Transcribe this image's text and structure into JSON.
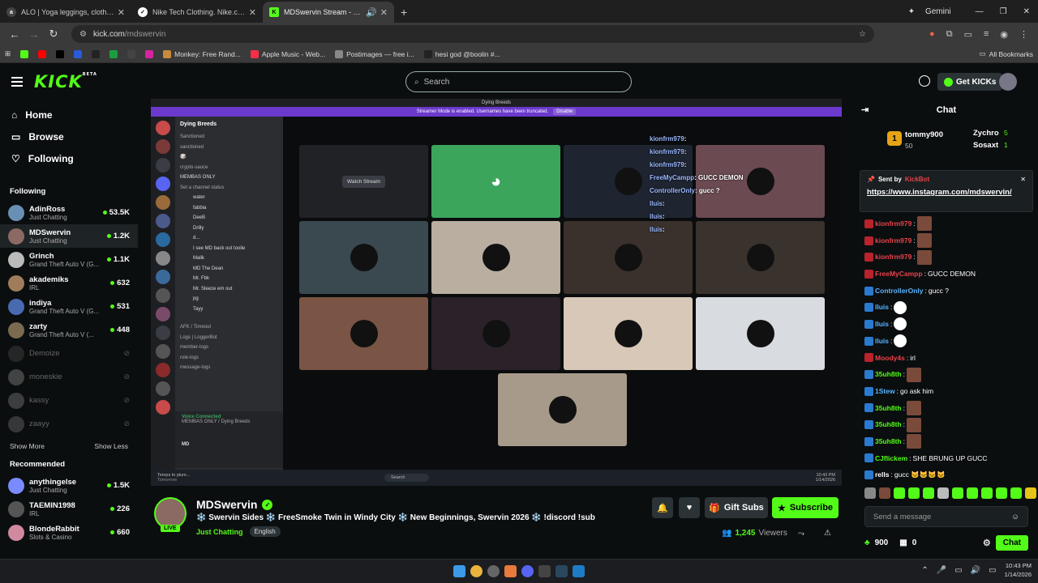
{
  "browser": {
    "tabs": [
      {
        "title": "ALO | Yoga leggings, clothes, a",
        "fav": "alo",
        "favColor": "#444"
      },
      {
        "title": "Nike Tech Clothing. Nike.com",
        "fav": "",
        "favColor": "#fff"
      },
      {
        "title": "MDSwervin Stream - Watch",
        "fav": "K",
        "favColor": "#53fc18"
      }
    ],
    "gemini_label": "Gemini",
    "url_host": "kick.com",
    "url_path": "/mdswervin",
    "bookmarks": [
      {
        "label": "",
        "color": "#53fc18"
      },
      {
        "label": "",
        "color": "#ff0000"
      },
      {
        "label": "",
        "color": "#000"
      },
      {
        "label": "",
        "color": "#2a5bd7"
      },
      {
        "label": "",
        "color": "#222"
      },
      {
        "label": "",
        "color": "#1b9e3e"
      },
      {
        "label": "",
        "color": "#444"
      },
      {
        "label": "",
        "color": "#d6249f"
      },
      {
        "label": "Monkey: Free Rand...",
        "color": "#c98a3a"
      },
      {
        "label": "Apple Music - Web...",
        "color": "#fa2d48"
      },
      {
        "label": "Postimages — free i...",
        "color": "#888"
      },
      {
        "label": "hesi god @boolin #...",
        "color": "#222"
      }
    ],
    "all_bookmarks": "All Bookmarks"
  },
  "header": {
    "logo": "KICK",
    "logo_badge": "BETA",
    "search_placeholder": "Search",
    "get_kicks": "Get KICKs"
  },
  "sidebar": {
    "nav": [
      {
        "label": "Home"
      },
      {
        "label": "Browse"
      },
      {
        "label": "Following"
      }
    ],
    "following_title": "Following",
    "following": [
      {
        "name": "AdinRoss",
        "cat": "Just Chatting",
        "viewers": "53.5K",
        "color": "#6a8fb5",
        "off": false
      },
      {
        "name": "MDSwervin",
        "cat": "Just Chatting",
        "viewers": "1.2K",
        "color": "#8a6a62",
        "off": false
      },
      {
        "name": "Grinch",
        "cat": "Grand Theft Auto V (G...",
        "viewers": "1.1K",
        "color": "#bbb",
        "off": false
      },
      {
        "name": "akademiks",
        "cat": "IRL",
        "viewers": "632",
        "color": "#a07d5a",
        "off": false
      },
      {
        "name": "indiya",
        "cat": "Grand Theft Auto V (G...",
        "viewers": "531",
        "color": "#4a6ab0",
        "off": false
      },
      {
        "name": "zarty",
        "cat": "Grand Theft Auto V (...",
        "viewers": "448",
        "color": "#7a6a50",
        "off": false
      },
      {
        "name": "Demoize",
        "cat": "",
        "viewers": "",
        "color": "#555",
        "off": true
      },
      {
        "name": "moneskie",
        "cat": "",
        "viewers": "",
        "color": "#aaa",
        "off": true
      },
      {
        "name": "kassy",
        "cat": "",
        "viewers": "",
        "color": "#999",
        "off": true
      },
      {
        "name": "zaayy",
        "cat": "",
        "viewers": "",
        "color": "#888",
        "off": true
      }
    ],
    "show_more": "Show More",
    "show_less": "Show Less",
    "recommended_title": "Recommended",
    "recommended": [
      {
        "name": "anythingelse",
        "cat": "Just Chatting",
        "viewers": "1.5K",
        "color": "#7a8aff"
      },
      {
        "name": "TAEMIN1998",
        "cat": "IRL",
        "viewers": "226",
        "color": "#555"
      },
      {
        "name": "BlondeRabbit",
        "cat": "Slots & Casino",
        "viewers": "660",
        "color": "#d08aa0"
      }
    ]
  },
  "stream": {
    "discord_title": "Dying Breeds",
    "banner_text": "Streamer Mode is enabled. Usernames have been truncated.",
    "banner_btn": "Disable",
    "server_name": "Dying Breeds",
    "channels": [
      "Sanctioned",
      "sanctioned",
      "🎲",
      "crypto-sauce",
      "MEMBAS ONLY",
      "Set a channel status"
    ],
    "voice_users": [
      "water",
      "fabbia",
      "DeeB",
      "Drilly",
      "d...",
      "I see MD back out toolie",
      "Malik",
      "MD The Dean",
      "Mr. Fbk",
      "Mr. Sleeze em out",
      "pg",
      "Tayy"
    ],
    "other_channels": [
      "AFK / Timeout",
      "Logs | LoggerBot",
      "member-logs",
      "role-logs",
      "message-logs"
    ],
    "voice_connected": "Voice Connected",
    "voice_sub": "MEMBAS ONLY / Dying Breeds",
    "me": "MD",
    "watch_stream": "Watch Stream",
    "overlay": [
      {
        "u": "kionfrm979",
        "t": ""
      },
      {
        "u": "kionfrm979",
        "t": ""
      },
      {
        "u": "kionfrm979",
        "t": ""
      },
      {
        "u": "FreeMyCampp",
        "t": "GUCC DEMON"
      },
      {
        "u": "ControllerOnly",
        "t": "gucc ?"
      },
      {
        "u": "lluis",
        "t": ""
      },
      {
        "u": "lluis",
        "t": ""
      },
      {
        "u": "lluis",
        "t": ""
      }
    ],
    "taskbar_left": "Temps to plum...",
    "taskbar_sub": "Tomorrow",
    "taskbar_search": "Search",
    "taskbar_time": "10:43 PM",
    "taskbar_date": "1/14/2026"
  },
  "channel": {
    "name": "MDSwervin",
    "live": "LIVE",
    "title": "❄️ Swervin Sides ❄️ FreeSmoke Twin in Windy City ❄️ New Beginnings, Swervin 2026 ❄️ !discord !sub",
    "category": "Just Chatting",
    "language": "English",
    "gift_subs": "Gift Subs",
    "subscribe": "Subscribe",
    "viewers": "1,245",
    "viewers_label": "Viewers"
  },
  "chat": {
    "title": "Chat",
    "leaders": [
      {
        "name": "tommy900",
        "amt": "50",
        "rank": "1"
      },
      {
        "name": "Zychro",
        "amt": "5"
      },
      {
        "name": "Sosaxt",
        "amt": "1"
      }
    ],
    "pinned_label": "Sent by",
    "pinned_by": "KickBot",
    "pinned_link": "https://www.instagram.com/mdswervin/",
    "messages": [
      {
        "u": "kionfrm979",
        "t": "",
        "c": "#e8424a",
        "em": 1
      },
      {
        "u": "kionfrm979",
        "t": "",
        "c": "#e8424a",
        "em": 1
      },
      {
        "u": "kionfrm979",
        "t": "",
        "c": "#e8424a",
        "em": 1
      },
      {
        "u": "FreeMyCampp",
        "t": "GUCC DEMON",
        "c": "#e8424a",
        "em": 0
      },
      {
        "u": "ControllerOnly",
        "t": "gucc ?",
        "c": "#5ab4ff",
        "em": 0
      },
      {
        "u": "lluis",
        "t": "",
        "c": "#5ab4ff",
        "em": 2
      },
      {
        "u": "lluis",
        "t": "",
        "c": "#5ab4ff",
        "em": 2
      },
      {
        "u": "lluis",
        "t": "",
        "c": "#5ab4ff",
        "em": 2
      },
      {
        "u": "Moody4s",
        "t": "irl",
        "c": "#e8424a",
        "em": 0
      },
      {
        "u": "35uh8th",
        "t": "",
        "c": "#53fc18",
        "em": 1
      },
      {
        "u": "1Stew",
        "t": "go ask him",
        "c": "#5ab4ff",
        "em": 0
      },
      {
        "u": "35uh8th",
        "t": "",
        "c": "#53fc18",
        "em": 1
      },
      {
        "u": "35uh8th",
        "t": "",
        "c": "#53fc18",
        "em": 1
      },
      {
        "u": "35uh8th",
        "t": "",
        "c": "#53fc18",
        "em": 1
      },
      {
        "u": "CJflickem",
        "t": "SHE BRUNG UP GUCC",
        "c": "#53fc18",
        "em": 0
      },
      {
        "u": "rells",
        "t": "gucc 🐱🐱🐱🐱",
        "c": "#fff",
        "em": 0
      }
    ],
    "send_placeholder": "Send a message",
    "kick_points": "900",
    "gift_count": "0",
    "chat_btn": "Chat"
  },
  "os": {
    "time": "10:43 PM",
    "date": "1/14/2026"
  }
}
